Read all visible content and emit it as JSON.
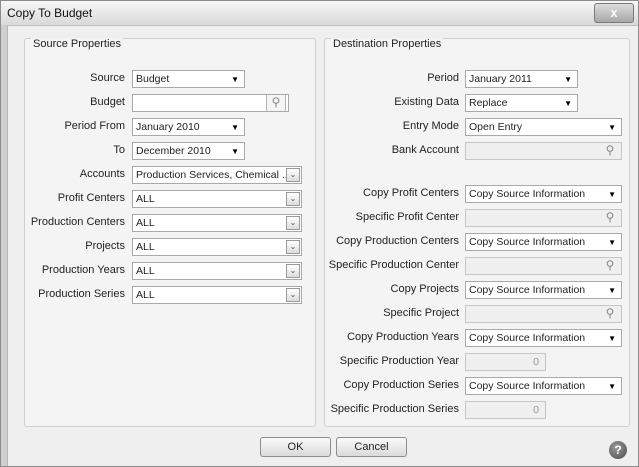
{
  "window": {
    "title": "Copy To Budget",
    "close_glyph": "x"
  },
  "source": {
    "heading": "Source Properties",
    "source_label": "Source",
    "source_value": "Budget",
    "budget_label": "Budget",
    "budget_value": "",
    "period_from_label": "Period From",
    "period_from_value": "January 2010",
    "to_label": "To",
    "to_value": "December 2010",
    "accounts_label": "Accounts",
    "accounts_value": "Production Services, Chemical ...",
    "profit_centers_label": "Profit Centers",
    "profit_centers_value": "ALL",
    "production_centers_label": "Production Centers",
    "production_centers_value": "ALL",
    "projects_label": "Projects",
    "projects_value": "ALL",
    "production_years_label": "Production Years",
    "production_years_value": "ALL",
    "production_series_label": "Production Series",
    "production_series_value": "ALL"
  },
  "destination": {
    "heading": "Destination Properties",
    "period_label": "Period",
    "period_value": "January 2011",
    "existing_data_label": "Existing Data",
    "existing_data_value": "Replace",
    "entry_mode_label": "Entry Mode",
    "entry_mode_value": "Open Entry",
    "bank_account_label": "Bank Account",
    "bank_account_value": "",
    "copy_profit_centers_label": "Copy Profit Centers",
    "copy_profit_centers_value": "Copy Source Information",
    "specific_profit_center_label": "Specific Profit Center",
    "specific_profit_center_value": "",
    "copy_production_centers_label": "Copy Production Centers",
    "copy_production_centers_value": "Copy Source Information",
    "specific_production_center_label": "Specific Production Center",
    "specific_production_center_value": "",
    "copy_projects_label": "Copy Projects",
    "copy_projects_value": "Copy Source Information",
    "specific_project_label": "Specific Project",
    "specific_project_value": "",
    "copy_production_years_label": "Copy Production Years",
    "copy_production_years_value": "Copy Source Information",
    "specific_production_year_label": "Specific Production Year",
    "specific_production_year_value": "0",
    "copy_production_series_label": "Copy Production Series",
    "copy_production_series_value": "Copy Source Information",
    "specific_production_series_label": "Specific Production Series",
    "specific_production_series_value": "0"
  },
  "buttons": {
    "ok": "OK",
    "cancel": "Cancel",
    "help": "?"
  },
  "glyphs": {
    "dropdown": "▼",
    "ellipsis": "⌄",
    "magnifier": "⚲"
  }
}
